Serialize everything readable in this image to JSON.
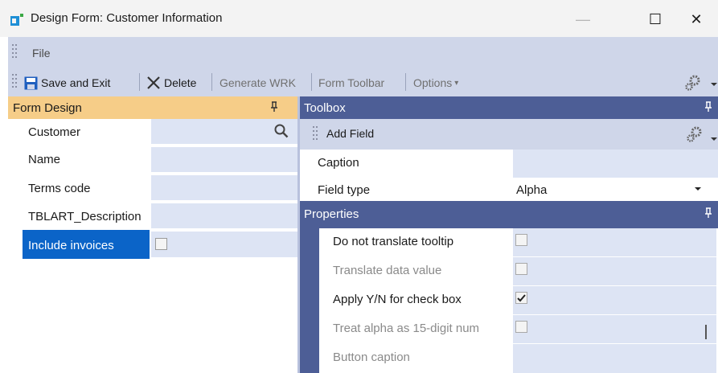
{
  "window": {
    "title": "Design Form: Customer Information",
    "minimize": "—",
    "maximize": "☐",
    "close": "✕",
    "icon": "app-form-icon"
  },
  "menu": {
    "file": "File"
  },
  "toolbar": {
    "save_exit": "Save and Exit",
    "delete": "Delete",
    "generate_wrk": "Generate WRK",
    "form_toolbar": "Form Toolbar",
    "options": "Options",
    "options_arrow": "▾",
    "settings_icon": "gear-icon"
  },
  "form_design": {
    "title": "Form Design",
    "pin": "ᥐ",
    "rows": [
      {
        "label": "Customer"
      },
      {
        "label": "Name"
      },
      {
        "label": "Terms code"
      },
      {
        "label": "TBLART_Description"
      },
      {
        "label": "Include invoices"
      }
    ],
    "search_icon": "search-icon"
  },
  "toolbox": {
    "title": "Toolbox",
    "add_field": "Add Field",
    "caption_label": "Caption",
    "caption_value": "",
    "field_type_label": "Field type",
    "field_type_value": "Alpha"
  },
  "properties": {
    "title": "Properties",
    "rows": [
      {
        "label": "Do not translate tooltip",
        "dim": false,
        "checked": false
      },
      {
        "label": "Translate data value",
        "dim": true,
        "checked": false
      },
      {
        "label": "Apply Y/N for check box",
        "dim": false,
        "checked": true
      },
      {
        "label": "Treat alpha as 15-digit num",
        "dim": true,
        "checked": false
      },
      {
        "label": "Button caption",
        "dim": true
      }
    ]
  },
  "colors": {
    "accent_header": "#f6cd88",
    "panel_header": "#4d5e96",
    "toolbar_bg": "#cfd6e9",
    "selected": "#0b64c8",
    "value_cell": "#dde4f4",
    "save_icon": "#1f5fbf"
  }
}
